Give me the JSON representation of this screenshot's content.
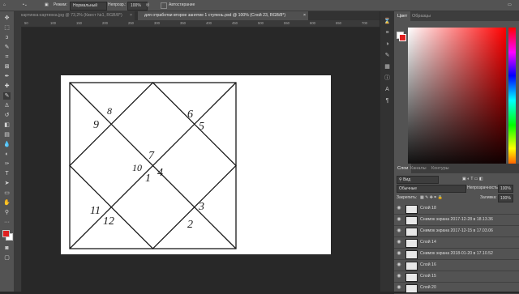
{
  "options_bar": {
    "mode_label": "Режим:",
    "mode_value": "Нормальный",
    "opacity_label": "Непрозр.:",
    "opacity_value": "100%",
    "flow_label": "Автостирание"
  },
  "document_tabs": [
    {
      "label": "картинка-картинка.jpg @ 73,2% (Квест №1, RGB/8*)",
      "close": "×"
    },
    {
      "label": "для отработки второе занятие 1 ступень.psd @ 100% (Слой 23, RGB/8*)",
      "close": "×"
    }
  ],
  "ruler_ticks": [
    "50",
    "100",
    "150",
    "200",
    "250",
    "300",
    "350",
    "400",
    "450",
    "500",
    "550",
    "600",
    "650",
    "700"
  ],
  "canvas": {
    "chart_numbers": [
      "8",
      "9",
      "6",
      "5",
      "7",
      "10",
      "1",
      "4",
      "11",
      "12",
      "3",
      "2"
    ]
  },
  "color_panel": {
    "tabs": [
      "Цвет",
      "Образцы"
    ],
    "foreground": "#e02020",
    "background": "#ffffff"
  },
  "layers_panel": {
    "tabs": [
      "Слои",
      "Каналы",
      "Контуры"
    ],
    "filter_value": "Вид",
    "blend_mode": "Обычные",
    "opacity_label": "Непрозрачность:",
    "opacity_value": "100%",
    "lock_label": "Закрепить:",
    "fill_label": "Заливка:",
    "fill_value": "100%",
    "layers": [
      {
        "name": "Слой 18"
      },
      {
        "name": "Снимок экрана 2017-12-28 в 18.13.36"
      },
      {
        "name": "Снимок экрана 2017-12-15 в 17.03.06"
      },
      {
        "name": "Слой 14"
      },
      {
        "name": "Снимок экрана 2018-01-20 в 17.10.52"
      },
      {
        "name": "Слой 16"
      },
      {
        "name": "Слой 15"
      },
      {
        "name": "Слой 20"
      }
    ]
  }
}
